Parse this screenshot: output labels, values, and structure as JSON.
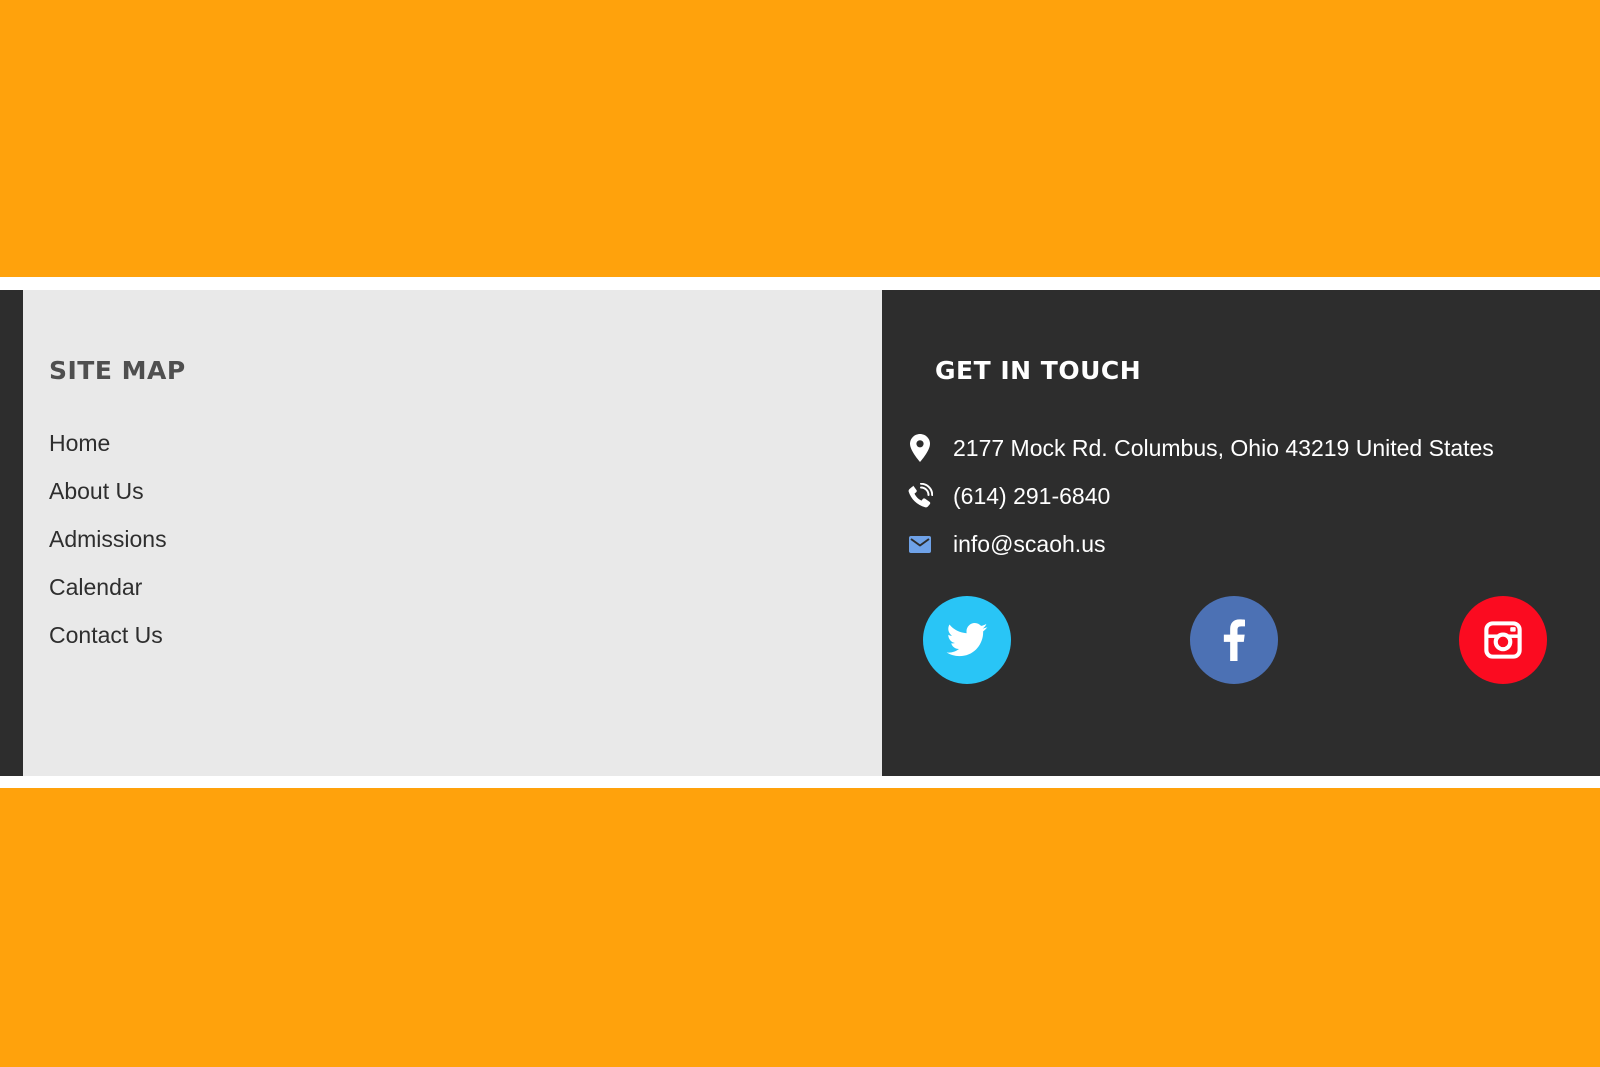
{
  "colors": {
    "accent_orange": "#ffa20c",
    "footer_dark": "#2d2d2d",
    "sitemap_bg": "#e9e9e9",
    "twitter": "#29c5f6",
    "facebook": "#4c71b4",
    "instagram": "#fb0b20",
    "email_icon": "#6fa2e8"
  },
  "sitemap": {
    "title": "SITE MAP",
    "links": [
      "Home",
      "About Us",
      "Admissions",
      "Calendar",
      "Contact Us"
    ]
  },
  "contact": {
    "title": "GET IN TOUCH",
    "address": "2177 Mock Rd. Columbus, Ohio 43219 United States",
    "phone": "(614) 291-6840",
    "email": "info@scaoh.us",
    "icons": {
      "address": "map-pin-icon",
      "phone": "phone-icon",
      "email": "envelope-icon"
    }
  },
  "social": [
    "twitter-icon",
    "facebook-icon",
    "instagram-icon"
  ]
}
